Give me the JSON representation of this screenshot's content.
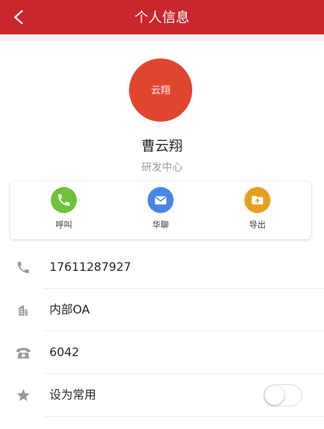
{
  "header": {
    "title": "个人信息",
    "back_icon": "chevron-left-icon"
  },
  "profile": {
    "avatar_text": "云翔",
    "avatar_color": "#e04530",
    "name": "曹云翔",
    "department": "研发中心"
  },
  "actions": [
    {
      "label": "呼叫",
      "icon": "phone-icon",
      "color": "#6fc23b"
    },
    {
      "label": "华聊",
      "icon": "mail-icon",
      "color": "#4a86e8"
    },
    {
      "label": "导出",
      "icon": "folder-upload-icon",
      "color": "#e5a021"
    }
  ],
  "info_rows": [
    {
      "icon": "phone-icon",
      "value": "17611287927"
    },
    {
      "icon": "building-icon",
      "value": "内部OA"
    },
    {
      "icon": "telephone-icon",
      "value": "6042"
    },
    {
      "icon": "star-icon",
      "value": "设为常用"
    }
  ],
  "favorite_toggle_on": false,
  "colors": {
    "header": "#c9262d"
  }
}
